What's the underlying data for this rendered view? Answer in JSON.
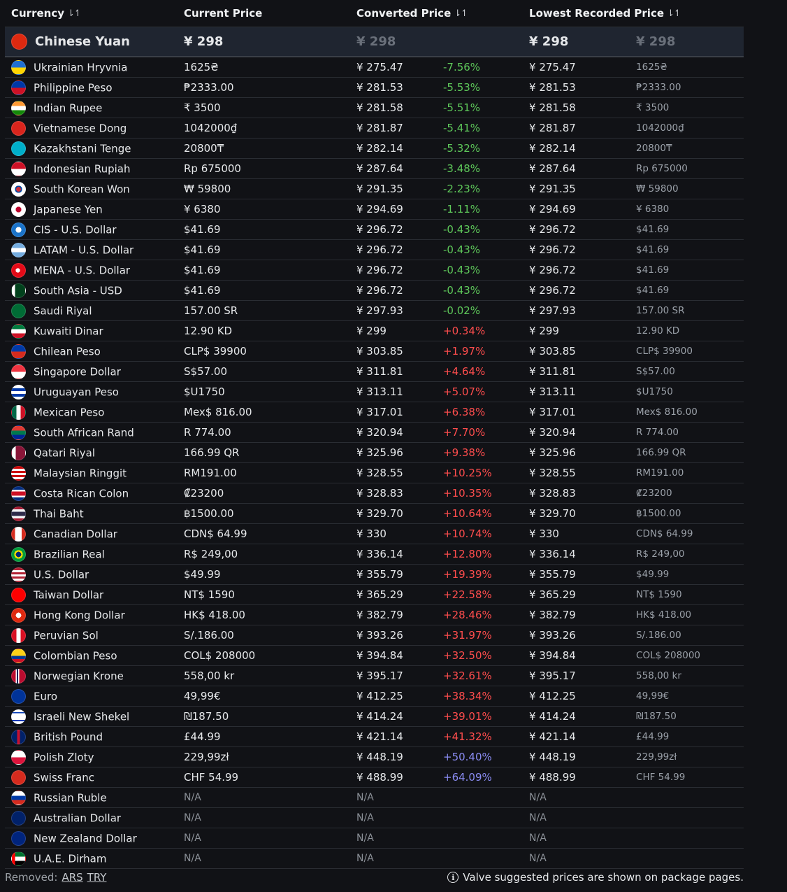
{
  "headers": {
    "currency": "Currency",
    "current_price": "Current Price",
    "converted_price": "Converted Price",
    "lowest_recorded_price": "Lowest Recorded Price",
    "sort_icon": "⇂↿"
  },
  "base": {
    "flag": "#de2910",
    "name": "Chinese Yuan",
    "price": "¥ 298",
    "converted": "¥ 298",
    "lowest": "¥ 298",
    "lowest_local": "¥ 298"
  },
  "rows": [
    {
      "flag": "linear-gradient(#1f6fd1 50%,#ffd500 50%)",
      "name": "Ukrainian Hryvnia",
      "price": "1625₴",
      "converted": "¥ 275.47",
      "pct": "-7.56%",
      "cls": "neg",
      "lowest": "¥ 275.47",
      "lowest_local": "1625₴"
    },
    {
      "flag": "linear-gradient(#0038a8 50%,#ce1126 50%)",
      "name": "Philippine Peso",
      "price": "₱2333.00",
      "converted": "¥ 281.53",
      "pct": "-5.53%",
      "cls": "neg",
      "lowest": "¥ 281.53",
      "lowest_local": "₱2333.00"
    },
    {
      "flag": "linear-gradient(#ff9933 33%,#ffffff 33% 66%,#138808 66%)",
      "name": "Indian Rupee",
      "price": "₹ 3500",
      "converted": "¥ 281.58",
      "pct": "-5.51%",
      "cls": "neg",
      "lowest": "¥ 281.58",
      "lowest_local": "₹ 3500"
    },
    {
      "flag": "#da251d",
      "name": "Vietnamese Dong",
      "price": "1042000₫",
      "converted": "¥ 281.87",
      "pct": "-5.41%",
      "cls": "neg",
      "lowest": "¥ 281.87",
      "lowest_local": "1042000₫"
    },
    {
      "flag": "#00afca",
      "name": "Kazakhstani Tenge",
      "price": "20800₸",
      "converted": "¥ 282.14",
      "pct": "-5.32%",
      "cls": "neg",
      "lowest": "¥ 282.14",
      "lowest_local": "20800₸"
    },
    {
      "flag": "linear-gradient(#ce1126 50%,#ffffff 50%)",
      "name": "Indonesian Rupiah",
      "price": "Rp 675000",
      "converted": "¥ 287.64",
      "pct": "-3.48%",
      "cls": "neg",
      "lowest": "¥ 287.64",
      "lowest_local": "Rp 675000"
    },
    {
      "flag": "radial-gradient(circle,#cd2e3a 0 25%,#0047a0 25% 38%,#ffffff 38%)",
      "name": "South Korean Won",
      "price": "₩ 59800",
      "converted": "¥ 291.35",
      "pct": "-2.23%",
      "cls": "neg",
      "lowest": "¥ 291.35",
      "lowest_local": "₩ 59800"
    },
    {
      "flag": "radial-gradient(circle,#bc002d 0 30%,#ffffff 31%)",
      "name": "Japanese Yen",
      "price": "¥ 6380",
      "converted": "¥ 294.69",
      "pct": "-1.11%",
      "cls": "neg",
      "lowest": "¥ 294.69",
      "lowest_local": "¥ 6380"
    },
    {
      "flag": "radial-gradient(circle,#ffffff 0 30%,#1a73c9 31%)",
      "name": "CIS - U.S. Dollar",
      "price": "$41.69",
      "converted": "¥ 296.72",
      "pct": "-0.43%",
      "cls": "neg",
      "lowest": "¥ 296.72",
      "lowest_local": "$41.69"
    },
    {
      "flag": "linear-gradient(#74acdf 33%,#ffffff 33% 66%,#74acdf 66%)",
      "name": "LATAM - U.S. Dollar",
      "price": "$41.69",
      "converted": "¥ 296.72",
      "pct": "-0.43%",
      "cls": "neg",
      "lowest": "¥ 296.72",
      "lowest_local": "$41.69"
    },
    {
      "flag": "radial-gradient(circle at 45% 50%,#ffffff 0 22%,#e30a17 23%)",
      "name": "MENA - U.S. Dollar",
      "price": "$41.69",
      "converted": "¥ 296.72",
      "pct": "-0.43%",
      "cls": "neg",
      "lowest": "¥ 296.72",
      "lowest_local": "$41.69"
    },
    {
      "flag": "linear-gradient(90deg,#ffffff 25%,#01411c 25%)",
      "name": "South Asia - USD",
      "price": "$41.69",
      "converted": "¥ 296.72",
      "pct": "-0.43%",
      "cls": "neg",
      "lowest": "¥ 296.72",
      "lowest_local": "$41.69"
    },
    {
      "flag": "#006c35",
      "name": "Saudi Riyal",
      "price": "157.00 SR",
      "converted": "¥ 297.93",
      "pct": "-0.02%",
      "cls": "neg",
      "lowest": "¥ 297.93",
      "lowest_local": "157.00 SR"
    },
    {
      "flag": "linear-gradient(#007a3d 33%,#ffffff 33% 66%,#ce1126 66%)",
      "name": "Kuwaiti Dinar",
      "price": "12.90 KD",
      "converted": "¥ 299",
      "pct": "+0.34%",
      "cls": "pos",
      "lowest": "¥ 299",
      "lowest_local": "12.90 KD"
    },
    {
      "flag": "linear-gradient(#0039a6 50%,#d52b1e 50%)",
      "name": "Chilean Peso",
      "price": "CLP$ 39900",
      "converted": "¥ 303.85",
      "pct": "+1.97%",
      "cls": "pos",
      "lowest": "¥ 303.85",
      "lowest_local": "CLP$ 39900"
    },
    {
      "flag": "linear-gradient(#ef3340 50%,#ffffff 50%)",
      "name": "Singapore Dollar",
      "price": "S$57.00",
      "converted": "¥ 311.81",
      "pct": "+4.64%",
      "cls": "pos",
      "lowest": "¥ 311.81",
      "lowest_local": "S$57.00"
    },
    {
      "flag": "repeating-linear-gradient(#ffffff 0 4px,#0038a8 4px 8px)",
      "name": "Uruguayan Peso",
      "price": "$U1750",
      "converted": "¥ 313.11",
      "pct": "+5.07%",
      "cls": "pos",
      "lowest": "¥ 313.11",
      "lowest_local": "$U1750"
    },
    {
      "flag": "linear-gradient(90deg,#006847 33%,#ffffff 33% 66%,#ce1126 66%)",
      "name": "Mexican Peso",
      "price": "Mex$ 816.00",
      "converted": "¥ 317.01",
      "pct": "+6.38%",
      "cls": "pos",
      "lowest": "¥ 317.01",
      "lowest_local": "Mex$ 816.00"
    },
    {
      "flag": "linear-gradient(#de3831 33%,#007a4d 33% 66%,#002395 66%)",
      "name": "South African Rand",
      "price": "R 774.00",
      "converted": "¥ 320.94",
      "pct": "+7.70%",
      "cls": "pos",
      "lowest": "¥ 320.94",
      "lowest_local": "R 774.00"
    },
    {
      "flag": "linear-gradient(90deg,#ffffff 30%,#8a1538 30%)",
      "name": "Qatari Riyal",
      "price": "166.99 QR",
      "converted": "¥ 325.96",
      "pct": "+9.38%",
      "cls": "pos",
      "lowest": "¥ 325.96",
      "lowest_local": "166.99 QR"
    },
    {
      "flag": "repeating-linear-gradient(#cc0001 0 3px,#ffffff 3px 6px)",
      "name": "Malaysian Ringgit",
      "price": "RM191.00",
      "converted": "¥ 328.55",
      "pct": "+10.25%",
      "cls": "pos",
      "lowest": "¥ 328.55",
      "lowest_local": "RM191.00"
    },
    {
      "flag": "linear-gradient(#002b7f 20%,#ffffff 20% 35%,#ce1126 35% 65%,#ffffff 65% 80%,#002b7f 80%)",
      "name": "Costa Rican Colon",
      "price": "₡23200",
      "converted": "¥ 328.83",
      "pct": "+10.35%",
      "cls": "pos",
      "lowest": "¥ 328.83",
      "lowest_local": "₡23200"
    },
    {
      "flag": "linear-gradient(#a51931 17%,#f4f5f8 17% 33%,#2d2a4a 33% 67%,#f4f5f8 67% 83%,#a51931 83%)",
      "name": "Thai Baht",
      "price": "฿1500.00",
      "converted": "¥ 329.70",
      "pct": "+10.64%",
      "cls": "pos",
      "lowest": "¥ 329.70",
      "lowest_local": "฿1500.00"
    },
    {
      "flag": "linear-gradient(90deg,#d52b1e 25%,#ffffff 25% 75%,#d52b1e 75%)",
      "name": "Canadian Dollar",
      "price": "CDN$ 64.99",
      "converted": "¥ 330",
      "pct": "+10.74%",
      "cls": "pos",
      "lowest": "¥ 330",
      "lowest_local": "CDN$ 64.99"
    },
    {
      "flag": "radial-gradient(circle,#002776 0 28%,#ffdf00 29% 45%,#009c3b 46%)",
      "name": "Brazilian Real",
      "price": "R$ 249,00",
      "converted": "¥ 336.14",
      "pct": "+12.80%",
      "cls": "pos",
      "lowest": "¥ 336.14",
      "lowest_local": "R$ 249,00"
    },
    {
      "flag": "repeating-linear-gradient(#b22234 0 3px,#ffffff 3px 6px)",
      "name": "U.S. Dollar",
      "price": "$49.99",
      "converted": "¥ 355.79",
      "pct": "+19.39%",
      "cls": "pos",
      "lowest": "¥ 355.79",
      "lowest_local": "$49.99"
    },
    {
      "flag": "#fe0000",
      "name": "Taiwan Dollar",
      "price": "NT$ 1590",
      "converted": "¥ 365.29",
      "pct": "+22.58%",
      "cls": "pos",
      "lowest": "¥ 365.29",
      "lowest_local": "NT$ 1590"
    },
    {
      "flag": "radial-gradient(circle,#ffffff 0 28%,#de2910 29%)",
      "name": "Hong Kong Dollar",
      "price": "HK$ 418.00",
      "converted": "¥ 382.79",
      "pct": "+28.46%",
      "cls": "pos",
      "lowest": "¥ 382.79",
      "lowest_local": "HK$ 418.00"
    },
    {
      "flag": "linear-gradient(90deg,#d91023 33%,#ffffff 33% 66%,#d91023 66%)",
      "name": "Peruvian Sol",
      "price": "S/.186.00",
      "converted": "¥ 393.26",
      "pct": "+31.97%",
      "cls": "pos",
      "lowest": "¥ 393.26",
      "lowest_local": "S/.186.00"
    },
    {
      "flag": "linear-gradient(#fcd116 50%,#003893 50% 75%,#ce1126 75%)",
      "name": "Colombian Peso",
      "price": "COL$ 208000",
      "converted": "¥ 394.84",
      "pct": "+32.50%",
      "cls": "pos",
      "lowest": "¥ 394.84",
      "lowest_local": "COL$ 208000"
    },
    {
      "flag": "linear-gradient(90deg,#ba0c2f 30%,#ffffff 30% 36%,#00205b 36% 48%,#ffffff 48% 54%,#ba0c2f 54%)",
      "name": "Norwegian Krone",
      "price": "558,00 kr",
      "converted": "¥ 395.17",
      "pct": "+32.61%",
      "cls": "pos",
      "lowest": "¥ 395.17",
      "lowest_local": "558,00 kr"
    },
    {
      "flag": "#003399",
      "name": "Euro",
      "price": "49,99€",
      "converted": "¥ 412.25",
      "pct": "+38.34%",
      "cls": "pos",
      "lowest": "¥ 412.25",
      "lowest_local": "49,99€"
    },
    {
      "flag": "linear-gradient(#ffffff 15%,#0038b8 15% 25%,#ffffff 25% 75%,#0038b8 75% 85%,#ffffff 85%)",
      "name": "Israeli New Shekel",
      "price": "₪187.50",
      "converted": "¥ 414.24",
      "pct": "+39.01%",
      "cls": "pos",
      "lowest": "¥ 414.24",
      "lowest_local": "₪187.50"
    },
    {
      "flag": "linear-gradient(90deg,#012169 40%,#c8102e 40% 60%,#012169 60%)",
      "name": "British Pound",
      "price": "£44.99",
      "converted": "¥ 421.14",
      "pct": "+41.32%",
      "cls": "pos",
      "lowest": "¥ 421.14",
      "lowest_local": "£44.99"
    },
    {
      "flag": "linear-gradient(#ffffff 50%,#dc143c 50%)",
      "name": "Polish Zloty",
      "price": "229,99zł",
      "converted": "¥ 448.19",
      "pct": "+50.40%",
      "cls": "hi",
      "lowest": "¥ 448.19",
      "lowest_local": "229,99zł"
    },
    {
      "flag": "#d52b1e",
      "name": "Swiss Franc",
      "price": "CHF 54.99",
      "converted": "¥ 488.99",
      "pct": "+64.09%",
      "cls": "hi",
      "lowest": "¥ 488.99",
      "lowest_local": "CHF 54.99"
    },
    {
      "flag": "linear-gradient(#ffffff 33%,#0039a6 33% 66%,#d52b1e 66%)",
      "name": "Russian Ruble",
      "price": "N/A",
      "converted": "N/A",
      "pct": "",
      "cls": "na",
      "lowest": "N/A",
      "lowest_local": ""
    },
    {
      "flag": "#012169",
      "name": "Australian Dollar",
      "price": "N/A",
      "converted": "N/A",
      "pct": "",
      "cls": "na",
      "lowest": "N/A",
      "lowest_local": ""
    },
    {
      "flag": "#00247d",
      "name": "New Zealand Dollar",
      "price": "N/A",
      "converted": "N/A",
      "pct": "",
      "cls": "na",
      "lowest": "N/A",
      "lowest_local": ""
    },
    {
      "flag": "linear-gradient(90deg,#ff0000 25%,transparent 25%),linear-gradient(#00732f 33%,#ffffff 33% 66%,#000000 66%)",
      "name": "U.A.E. Dirham",
      "price": "N/A",
      "converted": "N/A",
      "pct": "",
      "cls": "na",
      "lowest": "N/A",
      "lowest_local": ""
    }
  ],
  "footer": {
    "removed_label": "Removed:",
    "removed_links": [
      "ARS",
      "TRY"
    ],
    "note": "Valve suggested prices are shown on package pages.",
    "info_icon": "i"
  }
}
